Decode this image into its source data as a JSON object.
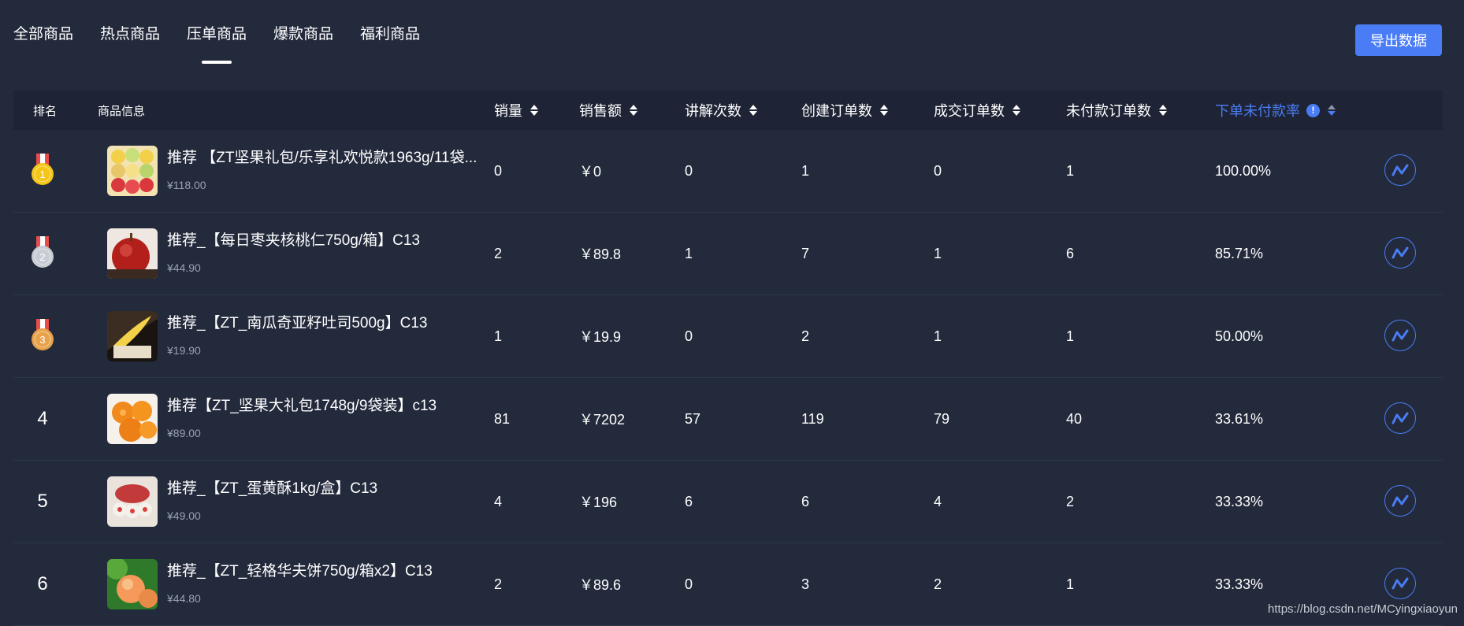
{
  "tabs": [
    {
      "label": "全部商品",
      "active": false
    },
    {
      "label": "热点商品",
      "active": false
    },
    {
      "label": "压单商品",
      "active": true
    },
    {
      "label": "爆款商品",
      "active": false
    },
    {
      "label": "福利商品",
      "active": false
    }
  ],
  "export_label": "导出数据",
  "columns": {
    "rank": "排名",
    "product": "商品信息",
    "sales": "销量",
    "revenue": "销售额",
    "explain": "讲解次数",
    "created": "创建订单数",
    "deal": "成交订单数",
    "unpaid": "未付款订单数",
    "unpaid_rate": "下单未付款率",
    "info_icon": "!"
  },
  "rows": [
    {
      "rank": "1",
      "title": "推荐 【ZT坚果礼包/乐享礼欢悦款1963g/11袋...",
      "price": "¥118.00",
      "sales": "0",
      "revenue": "￥0",
      "explain": "0",
      "created": "1",
      "deal": "0",
      "unpaid": "1",
      "rate": "100.00%"
    },
    {
      "rank": "2",
      "title": "推荐_【每日枣夹核桃仁750g/箱】C13",
      "price": "¥44.90",
      "sales": "2",
      "revenue": "￥89.8",
      "explain": "1",
      "created": "7",
      "deal": "1",
      "unpaid": "6",
      "rate": "85.71%"
    },
    {
      "rank": "3",
      "title": "推荐_【ZT_南瓜奇亚籽吐司500g】C13",
      "price": "¥19.90",
      "sales": "1",
      "revenue": "￥19.9",
      "explain": "0",
      "created": "2",
      "deal": "1",
      "unpaid": "1",
      "rate": "50.00%"
    },
    {
      "rank": "4",
      "title": "推荐【ZT_坚果大礼包1748g/9袋装】c13",
      "price": "¥89.00",
      "sales": "81",
      "revenue": "￥7202",
      "explain": "57",
      "created": "119",
      "deal": "79",
      "unpaid": "40",
      "rate": "33.61%"
    },
    {
      "rank": "5",
      "title": "推荐_【ZT_蛋黄酥1kg/盒】C13",
      "price": "¥49.00",
      "sales": "4",
      "revenue": "￥196",
      "explain": "6",
      "created": "6",
      "deal": "4",
      "unpaid": "2",
      "rate": "33.33%"
    },
    {
      "rank": "6",
      "title": "推荐_【ZT_轻格华夫饼750g/箱x2】C13",
      "price": "¥44.80",
      "sales": "2",
      "revenue": "￥89.6",
      "explain": "0",
      "created": "3",
      "deal": "2",
      "unpaid": "1",
      "rate": "33.33%"
    }
  ],
  "medal_colors": {
    "1": "#f5c518",
    "2": "#c9ccd3",
    "3": "#e8a24a"
  },
  "accent_color": "#4a7df5",
  "watermark": "https://blog.csdn.net/MCyingxiaoyun"
}
